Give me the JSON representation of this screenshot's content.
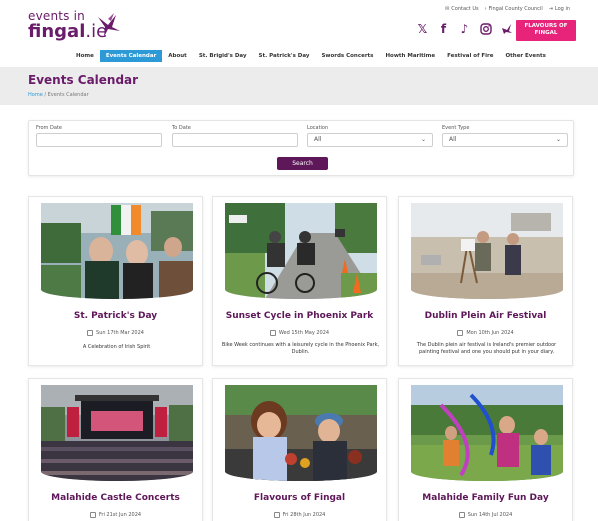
{
  "header": {
    "logo_line1": "events in",
    "logo_line2": "fingal",
    "logo_suffix": ".ie",
    "toplinks": [
      "Contact Us",
      "Fingal County Council",
      "Log in"
    ],
    "social_icons": [
      "x-icon",
      "facebook-icon",
      "tiktok-icon",
      "instagram-icon",
      "bird-icon"
    ],
    "flavours_line1": "FLAVOURS OF",
    "flavours_line2": "FINGAL",
    "accent": "#e8237a",
    "brand": "#6a1b6a"
  },
  "nav": {
    "items": [
      {
        "label": "Home"
      },
      {
        "label": "Events Calendar"
      },
      {
        "label": "About"
      },
      {
        "label": "St. Brigid's Day"
      },
      {
        "label": "St. Patrick's Day"
      },
      {
        "label": "Swords Concerts"
      },
      {
        "label": "Howth Maritime"
      },
      {
        "label": "Festival of Fire"
      },
      {
        "label": "Other Events"
      }
    ],
    "active_color": "#2b9ad6"
  },
  "page": {
    "title": "Events Calendar",
    "breadcrumb_home": "Home",
    "breadcrumb_sep": " / ",
    "breadcrumb_current": "Events Calendar"
  },
  "filters": {
    "from_label": "From Date",
    "to_label": "To Date",
    "location_label": "Location",
    "location_value": "All",
    "type_label": "Event Type",
    "type_value": "All",
    "search_label": "Search"
  },
  "cards": [
    {
      "title": "St. Patrick's Day",
      "date": "Sun 17th Mar 2024",
      "desc": "A Celebration of Irish Spirit"
    },
    {
      "title": "Sunset Cycle in Phoenix Park",
      "date": "Wed 15th May 2024",
      "desc": "Bike Week continues with a leisurely cycle in the Phoenix Park, Dublin."
    },
    {
      "title": "Dublin Plein Air Festival",
      "date": "Mon 10th Jun 2024",
      "desc": "The Dublin plein air festival is Ireland's premier outdoor painting festival and one you should put in your diary."
    },
    {
      "title": "Malahide Castle Concerts",
      "date": "Fri 21st Jun 2024",
      "desc": ""
    },
    {
      "title": "Flavours of Fingal",
      "date": "Fri 28th Jun 2024",
      "desc": ""
    },
    {
      "title": "Malahide Family Fun Day",
      "date": "Sun 14th Jul 2024",
      "desc": ""
    }
  ]
}
